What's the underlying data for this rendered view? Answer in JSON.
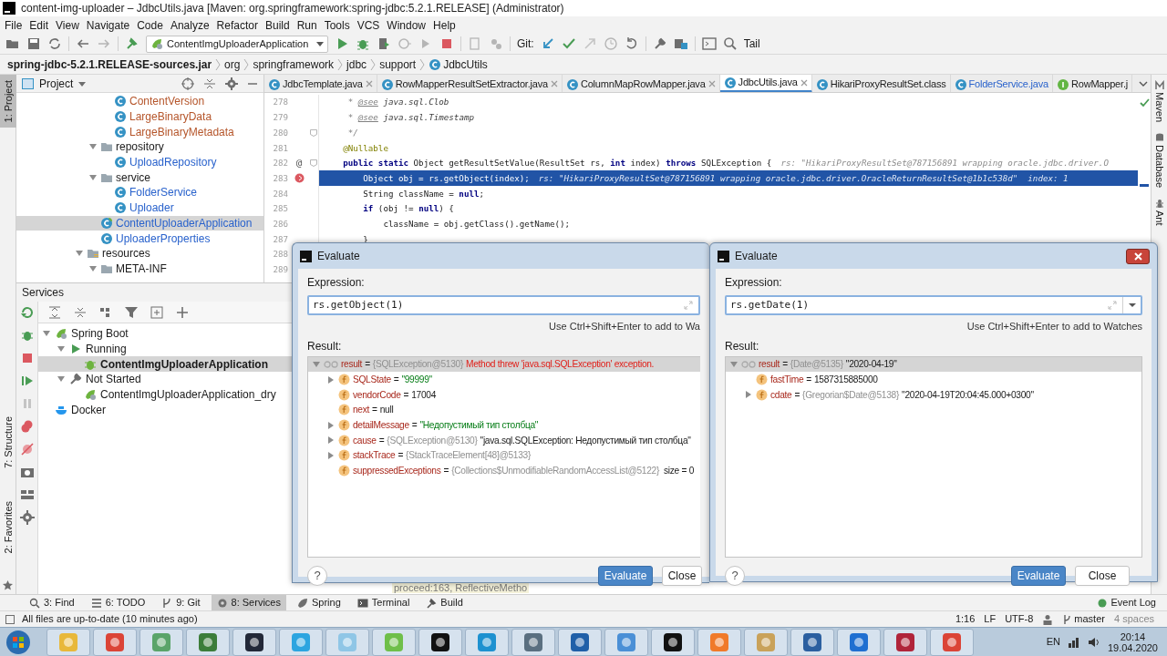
{
  "window": {
    "title": "content-img-uploader – JdbcUtils.java [Maven: org.springframework:spring-jdbc:5.2.1.RELEASE] (Administrator)"
  },
  "menu": [
    "File",
    "Edit",
    "View",
    "Navigate",
    "Code",
    "Analyze",
    "Refactor",
    "Build",
    "Run",
    "Tools",
    "VCS",
    "Window",
    "Help"
  ],
  "toolbar": {
    "run_config": "ContentImgUploaderApplication",
    "vcs_label": "Git:",
    "tail_label": "Tail"
  },
  "breadcrumbs": [
    {
      "label": "spring-jdbc-5.2.1.RELEASE-sources.jar",
      "kind": "jar"
    },
    {
      "label": "org",
      "kind": "package"
    },
    {
      "label": "springframework",
      "kind": "package"
    },
    {
      "label": "jdbc",
      "kind": "package"
    },
    {
      "label": "support",
      "kind": "package"
    },
    {
      "label": "JdbcUtils",
      "kind": "class"
    }
  ],
  "left_stripe": [
    {
      "label": "1: Project",
      "selected": true,
      "kind": "top"
    },
    {
      "label": "7: Structure",
      "selected": false,
      "kind": "bottom"
    },
    {
      "label": "2: Favorites",
      "selected": false,
      "kind": "bottom"
    }
  ],
  "right_stripe": [
    {
      "label": "Maven",
      "kind": "maven"
    },
    {
      "label": "Database",
      "kind": "database"
    },
    {
      "label": "Ant",
      "kind": "ant"
    }
  ],
  "project": {
    "title": "Project",
    "tree": {
      "children": [
        {
          "children": [
            {
              "children": [
                {
                  "label": "ContentVersion",
                  "kind": "class",
                  "unversioned": true,
                  "selected": false
                },
                {
                  "label": "LargeBinaryData",
                  "kind": "class",
                  "unversioned": true,
                  "selected": false
                },
                {
                  "label": "LargeBinaryMetadata",
                  "kind": "class",
                  "unversioned": true,
                  "selected": false
                }
              ]
            },
            {
              "label": "repository",
              "kind": "folder",
              "unversioned": false,
              "modified": false,
              "selected": false,
              "expanded": true,
              "children": [
                {
                  "label": "UploadRepository",
                  "kind": "class",
                  "unversioned": false,
                  "modified": true,
                  "selected": false
                }
              ]
            },
            {
              "label": "service",
              "kind": "folder",
              "unversioned": false,
              "modified": false,
              "selected": false,
              "expanded": true,
              "children": [
                {
                  "label": "FolderService",
                  "kind": "class",
                  "unversioned": false,
                  "modified": true,
                  "selected": false
                },
                {
                  "label": "Uploader",
                  "kind": "class",
                  "unversioned": false,
                  "modified": true,
                  "selected": false
                }
              ]
            },
            {
              "label": "ContentUploaderApplication",
              "kind": "spring_class",
              "unversioned": false,
              "modified": true,
              "selected": true
            },
            {
              "label": "UploaderProperties",
              "kind": "class",
              "unversioned": false,
              "modified": true,
              "selected": false
            }
          ]
        },
        {
          "label": "resources",
          "kind": "resources",
          "unversioned": false,
          "modified": false,
          "selected": false,
          "expanded": true,
          "children": [
            {
              "label": "META-INF",
              "kind": "folder",
              "unversioned": false,
              "modified": false,
              "selected": false,
              "expanded": true
            }
          ]
        }
      ]
    }
  },
  "tabs": [
    {
      "label": "JdbcTemplate.java",
      "kind": "class",
      "selected": false,
      "closable": true,
      "modified": false
    },
    {
      "label": "RowMapperResultSetExtractor.java",
      "kind": "class",
      "selected": false,
      "closable": true,
      "modified": false
    },
    {
      "label": "ColumnMapRowMapper.java",
      "kind": "class",
      "selected": false,
      "closable": true,
      "modified": false
    },
    {
      "label": "JdbcUtils.java",
      "kind": "class",
      "selected": true,
      "closable": true,
      "modified": false
    },
    {
      "label": "HikariProxyResultSet.class",
      "kind": "class",
      "selected": false,
      "closable": false,
      "modified": false
    },
    {
      "label": "FolderService.java",
      "kind": "class",
      "selected": false,
      "closable": false,
      "modified": true
    },
    {
      "label": "RowMapper.j",
      "kind": "interface",
      "selected": false,
      "closable": false,
      "modified": false
    }
  ],
  "code": [
    {
      "number": "278",
      "fold": false,
      "highlighted": false,
      "breakpoint": false,
      "tokens": [
        {
          "t": "     * ",
          "kind": "comment"
        },
        {
          "t": "@see",
          "kind": "doctag"
        },
        {
          "t": " java.sql.Clob",
          "kind": "docref"
        }
      ]
    },
    {
      "number": "279",
      "fold": false,
      "highlighted": false,
      "breakpoint": false,
      "tokens": [
        {
          "t": "     * ",
          "kind": "comment"
        },
        {
          "t": "@see",
          "kind": "doctag"
        },
        {
          "t": " java.sql.Timestamp",
          "kind": "docref"
        }
      ]
    },
    {
      "number": "280",
      "fold": true,
      "highlighted": false,
      "breakpoint": false,
      "tokens": [
        {
          "t": "     */",
          "kind": "comment"
        }
      ]
    },
    {
      "number": "281",
      "fold": false,
      "highlighted": false,
      "breakpoint": false,
      "tokens": [
        {
          "t": "    @Nullable",
          "kind": "annotation"
        }
      ]
    },
    {
      "number": "282",
      "fold": true,
      "highlighted": false,
      "breakpoint": false,
      "gutter_mark": "@",
      "tokens": [
        {
          "t": "    public static",
          "kind": "kw"
        },
        {
          "t": " Object getResultSetValue(ResultSet rs, ",
          "kind": "plain"
        },
        {
          "t": "int",
          "kind": "kw"
        },
        {
          "t": " index) ",
          "kind": "plain"
        },
        {
          "t": "throws",
          "kind": "kw"
        },
        {
          "t": " SQLException {",
          "kind": "plain"
        }
      ],
      "inline_value": "rs: \"HikariProxyResultSet@787156891 wrapping oracle.jdbc.driver.O"
    },
    {
      "number": "283",
      "fold": false,
      "highlighted": true,
      "breakpoint": true,
      "tokens": [
        {
          "t": "        Object obj = rs.getObject(index);",
          "kind": "plain"
        }
      ],
      "inline_value": "rs: \"HikariProxyResultSet@787156891 wrapping oracle.jdbc.driver.OracleReturnResultSet@1b1c538d\"  index: 1"
    },
    {
      "number": "284",
      "fold": false,
      "highlighted": false,
      "breakpoint": false,
      "tokens": [
        {
          "t": "        String className = ",
          "kind": "plain"
        },
        {
          "t": "null",
          "kind": "kw"
        },
        {
          "t": ";",
          "kind": "plain"
        }
      ]
    },
    {
      "number": "285",
      "fold": false,
      "highlighted": false,
      "breakpoint": false,
      "tokens": [
        {
          "t": "        if",
          "kind": "kw"
        },
        {
          "t": " (obj != ",
          "kind": "plain"
        },
        {
          "t": "null",
          "kind": "kw"
        },
        {
          "t": ") {",
          "kind": "plain"
        }
      ]
    },
    {
      "number": "286",
      "fold": false,
      "highlighted": false,
      "breakpoint": false,
      "tokens": [
        {
          "t": "            className = obj.getClass().getName();",
          "kind": "plain"
        }
      ]
    },
    {
      "number": "287",
      "fold": false,
      "highlighted": false,
      "breakpoint": false,
      "tokens": [
        {
          "t": "        }",
          "kind": "plain"
        }
      ]
    },
    {
      "number": "288"
    },
    {
      "number": "289"
    }
  ],
  "services": {
    "title": "Services",
    "tree": [
      {
        "label": "Spring Boot",
        "kind": "spring_boot",
        "expanded": true,
        "selected": false,
        "children": [
          {
            "label": "Running",
            "kind": "running",
            "expanded": true,
            "selected": false,
            "children": [
              {
                "label": "ContentImgUploaderApplication",
                "kind": "app_running",
                "selected": true
              }
            ]
          },
          {
            "label": "Not Started",
            "kind": "not_started",
            "expanded": true,
            "selected": false,
            "children": [
              {
                "label": "ContentImgUploaderApplication_dry",
                "kind": "app",
                "selected": false
              }
            ]
          }
        ]
      },
      {
        "label": "Docker",
        "kind": "docker",
        "selected": false
      }
    ],
    "frame": "proceed:163, ReflectiveMetho"
  },
  "dialogs": [
    {
      "title": "Evaluate",
      "close_button": false,
      "history_dropdown": false,
      "expression_label": "Expression:",
      "expression": "rs.getObject(1)",
      "hint": "Use Ctrl+Shift+Enter to add to Wa",
      "result_label": "Result:",
      "help": "?",
      "result": [
        {
          "name": "result",
          "op": "=",
          "ref": "{SQLException@5130}",
          "value": "Method threw 'java.sql.SQLException' exception.",
          "kind": "error",
          "expandable": true,
          "expanded": true,
          "selected": true,
          "children": [
            {
              "name": "SQLState",
              "op": "=",
              "value": "\"99999\"",
              "kind": "string",
              "expandable": true,
              "expanded": false,
              "selected": false
            },
            {
              "name": "vendorCode",
              "op": "=",
              "value": "17004",
              "kind": "plain",
              "expandable": false,
              "selected": false
            },
            {
              "name": "next",
              "op": "=",
              "value": "null",
              "kind": "plain",
              "expandable": false,
              "selected": false
            },
            {
              "name": "detailMessage",
              "op": "=",
              "value": "\"Недопустимый тип столбца\"",
              "kind": "string",
              "expandable": true,
              "expanded": false,
              "selected": false
            },
            {
              "name": "cause",
              "op": "=",
              "ref": "{SQLException@5130}",
              "value": "\"java.sql.SQLException: Недопустимый тип столбца\"",
              "kind": "plain",
              "expandable": true,
              "expanded": false,
              "selected": false
            },
            {
              "name": "stackTrace",
              "op": "=",
              "ref": "{StackTraceElement[48]@5133}",
              "expandable": true,
              "expanded": false,
              "selected": false
            },
            {
              "name": "suppressedExceptions",
              "op": "=",
              "ref": "{Collections$UnmodifiableRandomAccessList@5122}",
              "extra": "size = 0",
              "expandable": false,
              "selected": false
            }
          ]
        }
      ],
      "buttons": [
        {
          "label": "Evaluate",
          "primary": true
        },
        {
          "label": "Close",
          "primary": false
        }
      ]
    },
    {
      "title": "Evaluate",
      "close_button": true,
      "history_dropdown": true,
      "expression_label": "Expression:",
      "expression": "rs.getDate(1)",
      "hint": "Use Ctrl+Shift+Enter to add to Watches",
      "result_label": "Result:",
      "help": "?",
      "result": [
        {
          "name": "result",
          "op": "=",
          "ref": "{Date@5135}",
          "value": "\"2020-04-19\"",
          "kind": "plain",
          "expandable": true,
          "expanded": true,
          "selected": true,
          "children": [
            {
              "name": "fastTime",
              "op": "=",
              "value": "1587315885000",
              "kind": "plain",
              "expandable": false,
              "selected": false
            },
            {
              "name": "cdate",
              "op": "=",
              "ref": "{Gregorian$Date@5138}",
              "value": "\"2020-04-19T20:04:45.000+0300\"",
              "kind": "plain",
              "expandable": true,
              "expanded": false,
              "selected": false
            }
          ]
        }
      ],
      "buttons": [
        {
          "label": "Evaluate",
          "primary": true
        },
        {
          "label": "Close",
          "primary": false
        }
      ]
    }
  ],
  "tool_windows": [
    {
      "label": "3: Find",
      "kind": "find",
      "selected": false
    },
    {
      "label": "6: TODO",
      "kind": "todo",
      "selected": false
    },
    {
      "label": "9: Git",
      "kind": "git",
      "selected": false
    },
    {
      "label": "8: Services",
      "kind": "services",
      "selected": true
    },
    {
      "label": "Spring",
      "kind": "spring",
      "selected": false
    },
    {
      "label": "Terminal",
      "kind": "terminal",
      "selected": false
    },
    {
      "label": "Build",
      "kind": "build",
      "selected": false
    }
  ],
  "event_log": "Event Log",
  "status_bar": {
    "message": "All files are up-to-date (10 minutes ago)",
    "position": "1:16",
    "line_separator": "LF",
    "encoding": "UTF-8",
    "branch": "master",
    "indent": "4 spaces"
  },
  "taskbar": {
    "apps": [
      {
        "color": "#e8b83a"
      },
      {
        "color": "#db4437"
      },
      {
        "color": "#5aa469"
      },
      {
        "color": "#3c7d3a"
      },
      {
        "color": "#222838"
      },
      {
        "color": "#2ca5e0"
      },
      {
        "color": "#8fc6e6"
      },
      {
        "color": "#6fbf4a"
      },
      {
        "color": "#111111"
      },
      {
        "color": "#1d91d0"
      },
      {
        "color": "#5a6f80"
      },
      {
        "color": "#1f5fa8"
      },
      {
        "color": "#4a8fd6"
      },
      {
        "color": "#111111"
      },
      {
        "color": "#f07a2a"
      },
      {
        "color": "#c9a25a"
      },
      {
        "color": "#2b5fa0"
      },
      {
        "color": "#1f6fd1"
      },
      {
        "color": "#b0243a"
      },
      {
        "color": "#db4437"
      }
    ],
    "language": "EN",
    "time": "20:14",
    "date": "19.04.2020"
  }
}
